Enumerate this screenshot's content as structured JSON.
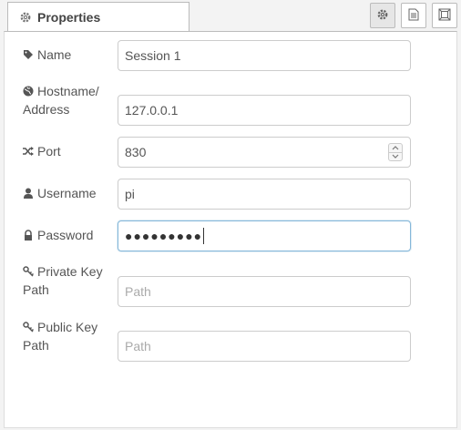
{
  "tabs": {
    "properties_label": "Properties"
  },
  "form": {
    "name": {
      "label": "Name",
      "value": "Session 1"
    },
    "hostname": {
      "label_line1": "Hostname/",
      "label_line2": "Address",
      "value": "127.0.0.1"
    },
    "port": {
      "label": "Port",
      "value": "830"
    },
    "username": {
      "label": "Username",
      "value": "pi"
    },
    "password": {
      "label": "Password",
      "masked_value": "●●●●●●●●●"
    },
    "private_key": {
      "label_line1": "Private Key",
      "label_line2": "Path",
      "placeholder": "Path",
      "value": ""
    },
    "public_key": {
      "label_line1": "Public Key",
      "label_line2": "Path",
      "placeholder": "Path",
      "value": ""
    }
  },
  "icons": {
    "properties_tab": "gear-icon",
    "toolbar": [
      "gear-icon",
      "document-icon",
      "frame-icon"
    ],
    "name": "tag-icon",
    "hostname": "globe-icon",
    "port": "shuffle-icon",
    "username": "user-icon",
    "password": "lock-icon",
    "private_key": "key-icon",
    "public_key": "key-icon"
  },
  "colors": {
    "focus_border": "#85b7d9",
    "label": "#555555",
    "placeholder": "#aaaaaa"
  }
}
